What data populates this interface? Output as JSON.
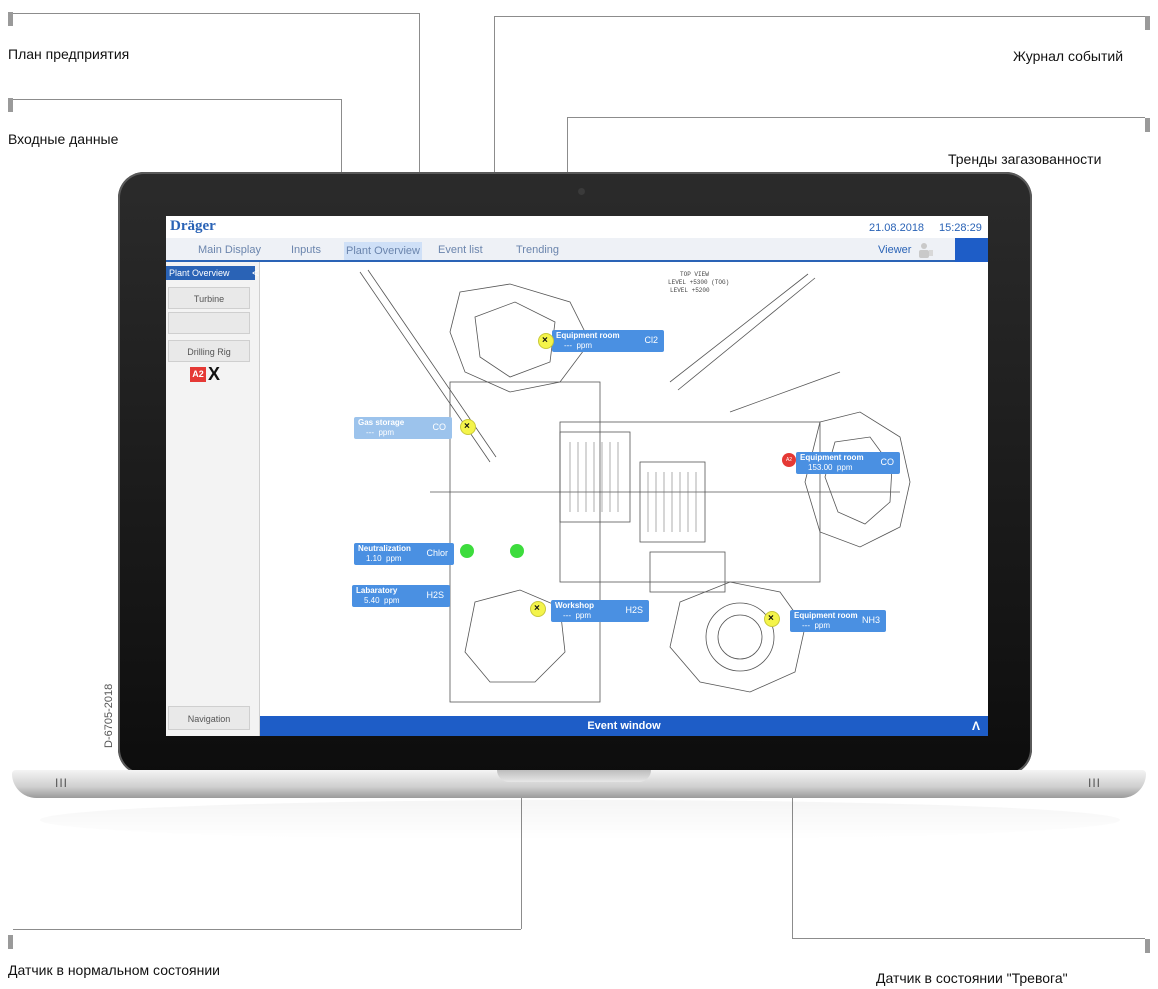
{
  "annotations": {
    "plant_plan": "План предприятия",
    "event_log": "Журнал событий",
    "inputs": "Входные данные",
    "gas_trends": "Тренды загазованности",
    "sensor_normal": "Датчик в нормальном состоянии",
    "sensor_alarm": "Датчик в состоянии \"Тревога\""
  },
  "doc_code": "D-6705-2018",
  "app": {
    "brand": "Dräger",
    "date": "21.08.2018",
    "time": "15:28:29",
    "tabs": [
      "Main Display",
      "Inputs",
      "Plant Overview",
      "Event list",
      "Trending"
    ],
    "active_tab": "Plant Overview",
    "user_role": "Viewer"
  },
  "sidebar": {
    "header": "Plant Overview",
    "items": [
      "Turbine",
      "",
      "Drilling Rig"
    ],
    "alarm_badge": "A2",
    "warning_badge": "X",
    "navigation": "Navigation"
  },
  "event_window": {
    "label": "Event window",
    "caret": "Λ"
  },
  "plan_text": {
    "title": "TOP VIEW",
    "level1": "LEVEL +5300 (TOG)",
    "level2": "LEVEL +5200"
  },
  "sensors": [
    {
      "name": "Equipment room",
      "value": "---",
      "unit": "ppm",
      "gas": "Cl2",
      "state": "warning"
    },
    {
      "name": "Gas storage",
      "value": "---",
      "unit": "ppm",
      "gas": "CO",
      "state": "warning"
    },
    {
      "name": "Equipment room",
      "value": "153.00",
      "unit": "ppm",
      "gas": "CO",
      "state": "alarm",
      "badge": "A2"
    },
    {
      "name": "Neutralization",
      "value": "1.10",
      "unit": "ppm",
      "gas": "Chlor",
      "state": "normal"
    },
    {
      "name": "Labaratory",
      "value": "5.40",
      "unit": "ppm",
      "gas": "H2S",
      "state": "normal"
    },
    {
      "name": "Workshop",
      "value": "---",
      "unit": "ppm",
      "gas": "H2S",
      "state": "warning"
    },
    {
      "name": "Equipment room",
      "value": "---",
      "unit": "ppm",
      "gas": "NH3",
      "state": "warning"
    }
  ],
  "colors": {
    "primary": "#1e5dc7",
    "tag": "#4a90e2",
    "alarm": "#e53935",
    "normal": "#3ddc3d",
    "warning": "#f4f44a"
  }
}
